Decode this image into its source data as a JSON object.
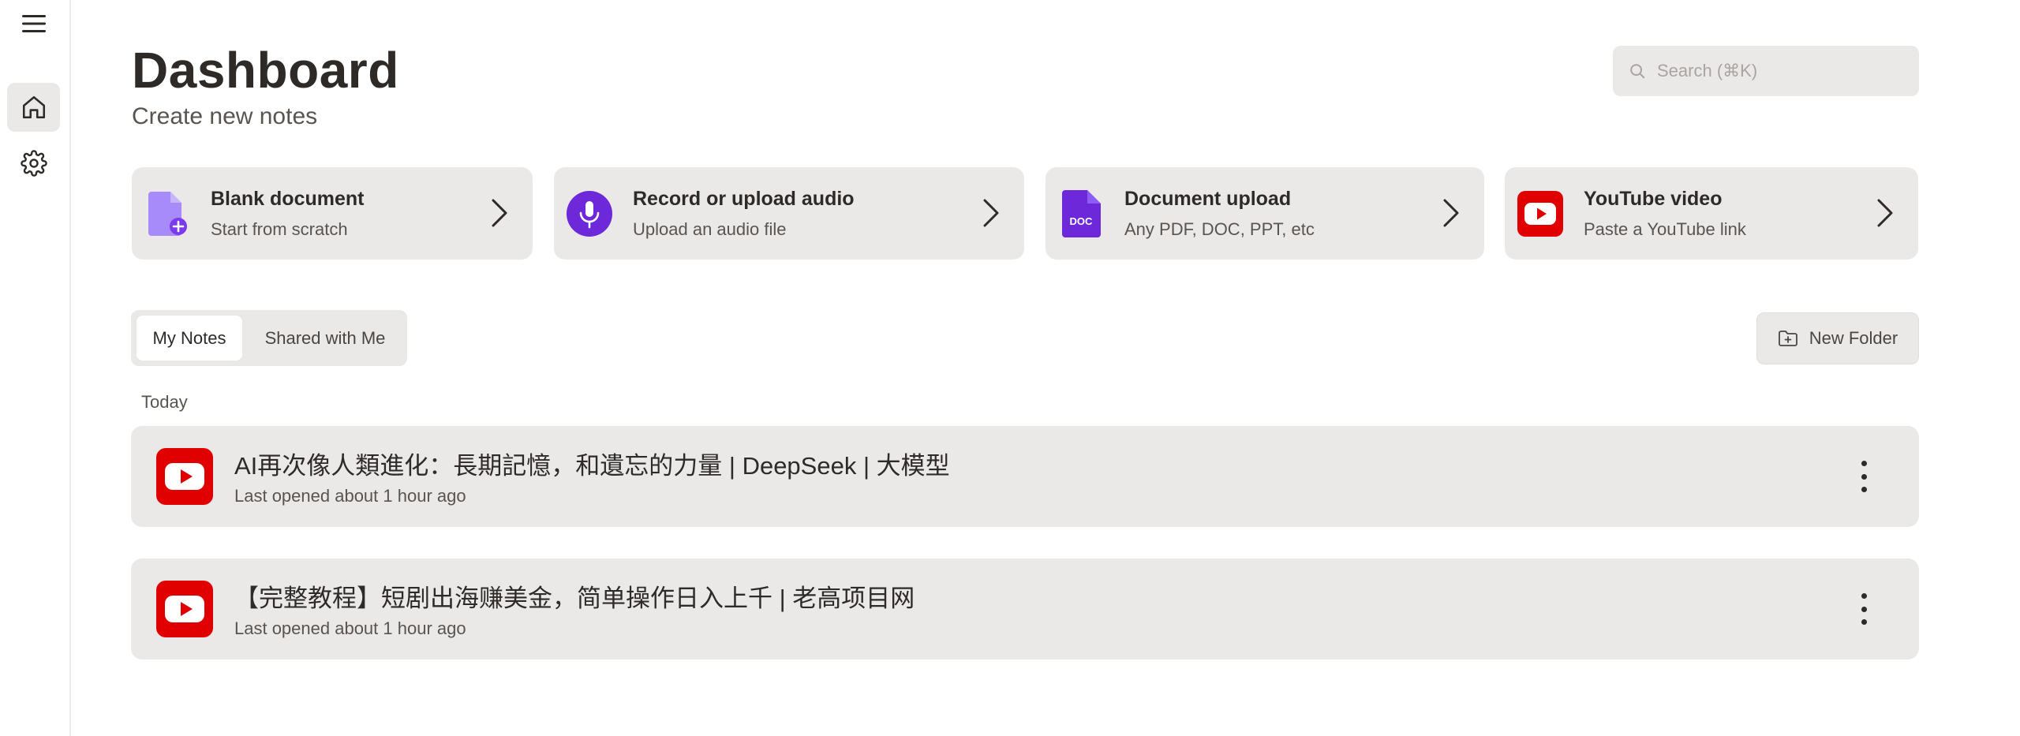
{
  "sidebar": {
    "menu_icon": "hamburger-menu-icon",
    "items": [
      {
        "icon": "home-icon",
        "active": true
      },
      {
        "icon": "gear-icon",
        "active": false
      }
    ]
  },
  "header": {
    "title": "Dashboard",
    "subtitle": "Create new notes"
  },
  "search": {
    "placeholder": "Search (⌘K)",
    "icon": "search-icon"
  },
  "quick_actions": [
    {
      "title": "Blank document",
      "subtitle": "Start from scratch",
      "icon": "blank-document-icon",
      "color": "#8b5cf6"
    },
    {
      "title": "Record or upload audio",
      "subtitle": "Upload an audio file",
      "icon": "microphone-icon",
      "color": "#6d28d9"
    },
    {
      "title": "Document upload",
      "subtitle": "Any PDF, DOC, PPT, etc",
      "icon": "doc-file-icon",
      "icon_text": "DOC",
      "color": "#6d28d9"
    },
    {
      "title": "YouTube video",
      "subtitle": "Paste a YouTube link",
      "icon": "youtube-icon",
      "color": "#e00000"
    }
  ],
  "tabs": [
    {
      "label": "My Notes",
      "active": true
    },
    {
      "label": "Shared with Me",
      "active": false
    }
  ],
  "new_folder": {
    "label": "New Folder",
    "icon": "folder-plus-icon"
  },
  "section": {
    "label": "Today"
  },
  "notes": [
    {
      "title": "AI再次像人類進化：長期記憶，和遺忘的力量 | DeepSeek | 大模型",
      "meta": "Last opened about 1 hour ago",
      "icon": "youtube-icon"
    },
    {
      "title": "【完整教程】短剧出海赚美金，简单操作日入上千 | 老高项目网",
      "meta": "Last opened about 1 hour ago",
      "icon": "youtube-icon"
    }
  ],
  "colors": {
    "accent_purple": "#6d28d9",
    "youtube_red": "#e00000",
    "card_bg": "#ebe9e8",
    "text_primary": "#2e2a28"
  }
}
